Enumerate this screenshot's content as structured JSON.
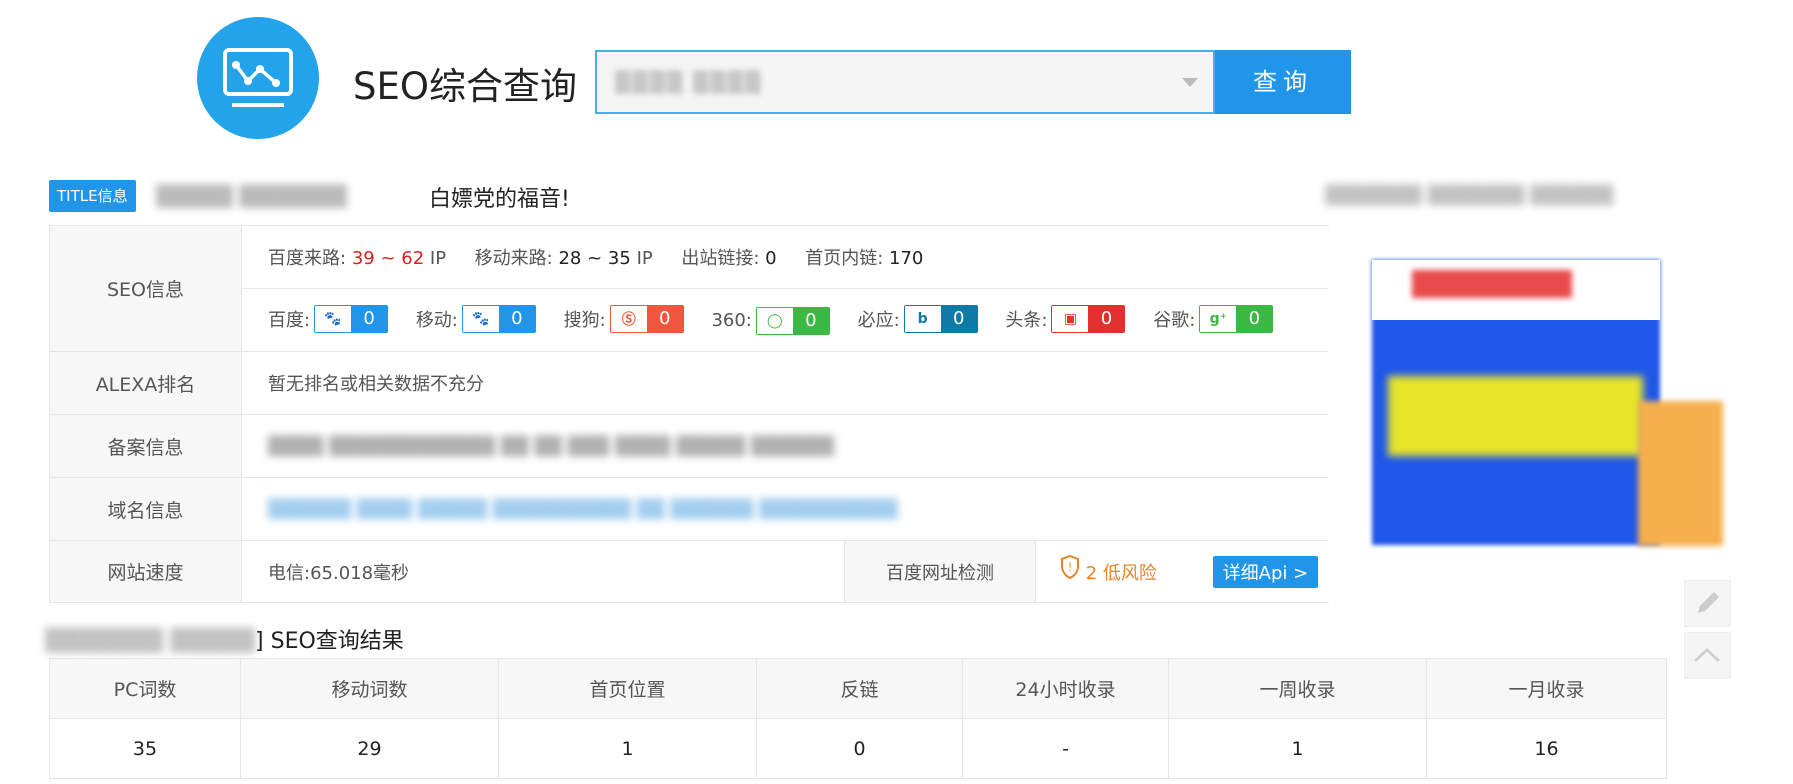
{
  "header": {
    "title": "SEO综合查询",
    "search_value": "▒▒▒▒ ▒▒▒▒",
    "query_button": "查询"
  },
  "title_info": {
    "tag": "TITLE信息",
    "blurred_text": "▒▒▒▒▒ ▒▒▒▒▒▒▒",
    "tail": "白嫖党的福音!"
  },
  "seo_info": {
    "label": "SEO信息",
    "baidu_traffic_label": "百度来路:",
    "baidu_traffic_value": "39 ~ 62",
    "ip_unit": "IP",
    "mobile_traffic_label": "移动来路:",
    "mobile_traffic_value": "28 ~ 35",
    "outbound_label": "出站链接:",
    "outbound_value": "0",
    "internal_label": "首页内链:",
    "internal_value": "170",
    "engines": [
      {
        "name": "百度:",
        "icon": "paw-icon",
        "value": "0",
        "color": "#2196e8"
      },
      {
        "name": "移动:",
        "icon": "paw-icon",
        "value": "0",
        "color": "#2196e8"
      },
      {
        "name": "搜狗:",
        "icon": "sogou-icon",
        "value": "0",
        "color": "#f0563d"
      },
      {
        "name": "360:",
        "icon": "ring-icon",
        "value": "0",
        "color": "#3cb845"
      },
      {
        "name": "必应:",
        "icon": "bing-icon",
        "value": "0",
        "color": "#0f7aa5"
      },
      {
        "name": "头条:",
        "icon": "toutiao-icon",
        "value": "0",
        "color": "#e0312f"
      },
      {
        "name": "谷歌:",
        "icon": "gplus-icon",
        "value": "0",
        "color": "#3cb845"
      }
    ]
  },
  "alexa": {
    "label": "ALEXA排名",
    "value": "暂无排名或相关数据不充分"
  },
  "icp": {
    "label": "备案信息",
    "value": "▒▒▒▒ ▒▒▒▒▒▒▒▒▒▒▒▒ ▒▒ ▒▒ ▒▒▒ ▒▒▒▒ ▒▒▒▒▒ ▒▒▒▒▒▒"
  },
  "domain": {
    "label": "域名信息",
    "value": "▒▒▒▒▒▒ ▒▒▒▒ ▒▒▒▒▒ ▒▒▒▒▒▒▒▒▒▒ ▒▒ ▒▒▒▒▒▒ ▒▒▒▒▒▒▒▒▒▒"
  },
  "speed": {
    "label": "网站速度",
    "value": "电信:65.018毫秒",
    "check_label": "百度网址检测",
    "risk_text": "2 低风险",
    "api_button": "详细Api >"
  },
  "thumbnail": {
    "caption": "▒▒▒▒▒▒▒ ▒▒▒▒▒▒▒ ▒▒▒▒▒▒"
  },
  "results": {
    "title_blur": "▒▒▒▒▒▒▒ ▒▒▒▒▒",
    "title_suffix": "] SEO查询结果",
    "headers": [
      "PC词数",
      "移动词数",
      "首页位置",
      "反链",
      "24小时收录",
      "一周收录",
      "一月收录"
    ],
    "row": [
      "35",
      "29",
      "1",
      "0",
      "-",
      "1",
      "16"
    ]
  }
}
